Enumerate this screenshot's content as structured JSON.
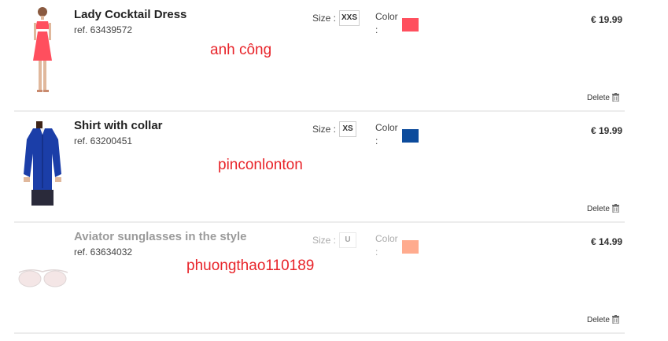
{
  "items": [
    {
      "title": "Lady Cocktail Dress",
      "ref": "ref. 63439572",
      "size_label": "Size :",
      "size": "XXS",
      "color_label": "Color :",
      "color_hex": "#ff4f5e",
      "price": "€ 19.99",
      "delete_label": "Delete",
      "overlay_text": "anh công"
    },
    {
      "title": "Shirt with collar",
      "ref": "ref. 63200451",
      "size_label": "Size :",
      "size": "XS",
      "color_label": "Color :",
      "color_hex": "#0c4b9c",
      "price": "€ 19.99",
      "delete_label": "Delete",
      "overlay_text": "pinconlonton"
    },
    {
      "title": "Aviator sunglasses in the style",
      "ref": "ref. 63634032",
      "size_label": "Size :",
      "size": "U",
      "color_label": "Color :",
      "color_hex": "#ffab8e",
      "price": "€ 14.99",
      "delete_label": "Delete",
      "overlay_text": "phuongthao110189"
    }
  ],
  "icons": {
    "delete": "trash-icon",
    "product_1": "dress-product-image",
    "product_2": "shirt-product-image",
    "product_3": "sunglasses-product-image"
  }
}
